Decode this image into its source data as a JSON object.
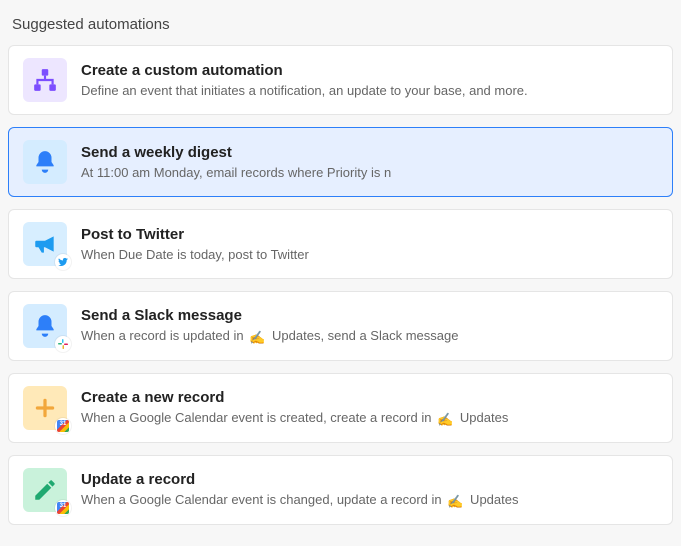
{
  "section_title": "Suggested automations",
  "items": [
    {
      "title": "Create a custom automation",
      "desc": "Define an event that initiates a notification, an update to your base, and more."
    },
    {
      "title": "Send a weekly digest",
      "desc": "At 11:00 am Monday, email records where Priority is n"
    },
    {
      "title": "Post to Twitter",
      "desc": "When Due Date is today, post to Twitter"
    },
    {
      "title": "Send a Slack message",
      "desc_pre": "When a record is updated in ",
      "desc_post": " Updates, send a Slack message"
    },
    {
      "title": "Create a new record",
      "desc_pre": "When a Google Calendar event is created, create a record in ",
      "desc_post": " Updates"
    },
    {
      "title": "Update a record",
      "desc_pre": "When a Google Calendar event is changed, update a record in ",
      "desc_post": " Updates"
    }
  ]
}
